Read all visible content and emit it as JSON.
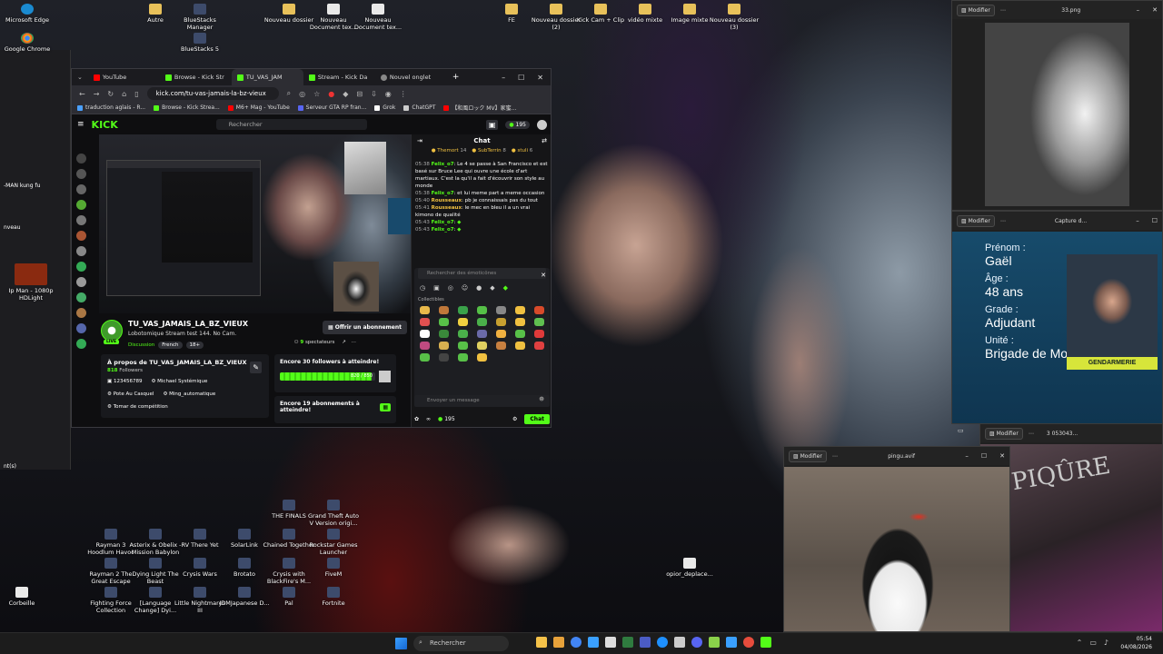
{
  "desktop": {
    "icons": [
      {
        "label": "Microsoft Edge",
        "kind": "edge"
      },
      {
        "label": "Autre",
        "kind": "fold"
      },
      {
        "label": "BlueStacks Manager",
        "kind": "app"
      },
      {
        "label": "Nouveau dossier",
        "kind": "fold"
      },
      {
        "label": "Nouveau Document tex...",
        "kind": "doc"
      },
      {
        "label": "Nouveau Document tex...",
        "kind": "doc"
      },
      {
        "label": "FE",
        "kind": "fold"
      },
      {
        "label": "Nouveau dossier (2)",
        "kind": "fold"
      },
      {
        "label": "Kick Cam + Clip",
        "kind": "fold"
      },
      {
        "label": "vidéo mixte",
        "kind": "fold"
      },
      {
        "label": "Image mixte",
        "kind": "fold"
      },
      {
        "label": "Nouveau dossier (3)",
        "kind": "fold"
      },
      {
        "label": "Google Chrome",
        "kind": "chrome"
      },
      {
        "label": "BlueStacks 5",
        "kind": "app"
      },
      {
        "label": "Ip Man - 1080p HDLight",
        "kind": "app"
      },
      {
        "label": "THE FINALS",
        "kind": "app"
      },
      {
        "label": "Grand Theft Auto V Version origi...",
        "kind": "app"
      },
      {
        "label": "Rayman 3 Hoodlum Havoc",
        "kind": "app"
      },
      {
        "label": "Asterix & Obelix - Mission Babylon",
        "kind": "app"
      },
      {
        "label": "RV There Yet",
        "kind": "app"
      },
      {
        "label": "SolarLink",
        "kind": "app"
      },
      {
        "label": "Chained Together",
        "kind": "app"
      },
      {
        "label": "Rockstar Games Launcher",
        "kind": "app"
      },
      {
        "label": "Rayman 2 The Great Escape",
        "kind": "app"
      },
      {
        "label": "Dying Light The Beast",
        "kind": "app"
      },
      {
        "label": "Crysis Wars",
        "kind": "app"
      },
      {
        "label": "Brotato",
        "kind": "app"
      },
      {
        "label": "Crysis with BlackFire's M...",
        "kind": "app"
      },
      {
        "label": "FiveM",
        "kind": "app"
      },
      {
        "label": "opior_deplace...",
        "kind": "doc"
      },
      {
        "label": "Corbeille",
        "kind": "doc"
      },
      {
        "label": "Fighting Force Collection",
        "kind": "app"
      },
      {
        "label": "[Language Change] Dyi...",
        "kind": "app"
      },
      {
        "label": "Little Nightmares III",
        "kind": "app"
      },
      {
        "label": "JDMJapanese D...",
        "kind": "app"
      },
      {
        "label": "Pal",
        "kind": "app"
      },
      {
        "label": "Fortnite",
        "kind": "app"
      }
    ],
    "left_window": {
      "lines": [
        "-MAN kung fu",
        "nveau",
        "nt(s)"
      ]
    }
  },
  "browser": {
    "tabs": [
      {
        "label": "YouTube",
        "color": "#ff0000"
      },
      {
        "label": "Browse - Kick Str",
        "color": "#53fc18"
      },
      {
        "label": "TU_VAS_JAM",
        "color": "#53fc18"
      },
      {
        "label": "Stream - Kick Da",
        "color": "#53fc18"
      },
      {
        "label": "Nouvel onglet",
        "color": "#888888"
      }
    ],
    "url": "kick.com/tu-vas-jamais-la-bz-vieux",
    "bookmarks": [
      {
        "label": "traduction aglais - R...",
        "color": "#4aa0ff"
      },
      {
        "label": "Browse - Kick Strea...",
        "color": "#53fc18"
      },
      {
        "label": "M6+ Mag - YouTube",
        "color": "#ff0000"
      },
      {
        "label": "Serveur GTA RP fran...",
        "color": "#5865f2"
      },
      {
        "label": "Grok",
        "color": "#ffffff"
      },
      {
        "label": "ChatGPT",
        "color": "#cccccc"
      },
      {
        "label": "【和風ロック MV】家蜜...",
        "color": "#ff0000"
      }
    ]
  },
  "kick": {
    "logo": "KICK",
    "search_placeholder": "Rechercher",
    "coins": "195",
    "channel": {
      "name": "TU_VAS_JAMAIS_LA_BZ_VIEUX",
      "live_badge": "LIVE",
      "title": "Lobotomique Stream test 144. No Cam.",
      "category": "Discussion",
      "tags": [
        "French",
        "18+"
      ],
      "subscribe": "Offrir un abonnement",
      "viewers_count": "9",
      "viewers_label": "spectateurs"
    },
    "about": {
      "title": "À propos de TU_VAS_JAMAIS_LA_BZ_VIEUX",
      "followers_count": "818",
      "followers_label": "Followers",
      "socials": [
        "123456789",
        "Michael Systémique",
        "Pote Au Casquel",
        "Ming_automatique",
        "Tomar de compétition"
      ]
    },
    "goal1": {
      "title": "Encore 30 followers à atteindre!",
      "current": 820,
      "target": 850,
      "progress_label": "820 / 850"
    },
    "goal2": {
      "title": "Encore 19 abonnements à atteindre!"
    },
    "chat": {
      "title": "Chat",
      "leaders": [
        {
          "name": "Themort",
          "count": "14"
        },
        {
          "name": "SubTerrin",
          "count": "8"
        },
        {
          "name": "stuli",
          "count": "6"
        }
      ],
      "messages": [
        {
          "time": "05:38",
          "user": "Felix_o7",
          "utype": "u1",
          "text": "Le 4 se passe à San Francisco et est basé sur Bruce Lee qui ouvre une école d'art martiaux. C'est la qu'il a fait d'écouvrir son style au monde"
        },
        {
          "time": "05:38",
          "user": "Felix_o7",
          "utype": "u1",
          "text": "et lui meme part a meme occasion"
        },
        {
          "time": "05:40",
          "user": "Rousseaux",
          "utype": "u2",
          "text": "pb je connaissais pas du tout"
        },
        {
          "time": "05:41",
          "user": "Rousseaux",
          "utype": "u2",
          "text": "le mec en bleu il a un vrai kimono de qualité"
        },
        {
          "time": "05:43",
          "user": "Felix_o7",
          "utype": "u1",
          "text": ""
        },
        {
          "time": "05:43",
          "user": "Felix_o7",
          "utype": "u1",
          "text": ""
        }
      ],
      "emote_search": "Rechercher des émoticônes",
      "emote_section": "Collectibles",
      "input_placeholder": "Envoyer un message",
      "points": "195",
      "send": "Chat"
    }
  },
  "photos": {
    "modify": "Modifier",
    "win1": {
      "file": "33.png"
    },
    "win2": {
      "file": "Capture d..."
    },
    "win3": {
      "file": "3 053043..."
    },
    "win4": {
      "file": "pingu.avif"
    },
    "card": {
      "prenom_l": "Prénom :",
      "prenom": "Gaël",
      "age_l": "Âge :",
      "age": "48 ans",
      "grade_l": "Grade :",
      "grade": "Adjudant",
      "unite_l": "Unité :",
      "unite": "Brigade de Mougins",
      "badge": "GENDARMERIE"
    },
    "poster_text": "PIQÛRE"
  },
  "taskbar": {
    "search": "Rechercher",
    "time": "05:54",
    "date": "04/08/2026",
    "apps": [
      "#f5c249",
      "#e8a23a",
      "#4285f4",
      "#3aa0ff",
      "#ffffff",
      "#2f7b3f",
      "#4b5cc4",
      "#1e90ff",
      "#cccccc",
      "#5865f2",
      "#8ad14a",
      "#3aa0ff",
      "#e74c3c",
      "#53fc18"
    ]
  }
}
